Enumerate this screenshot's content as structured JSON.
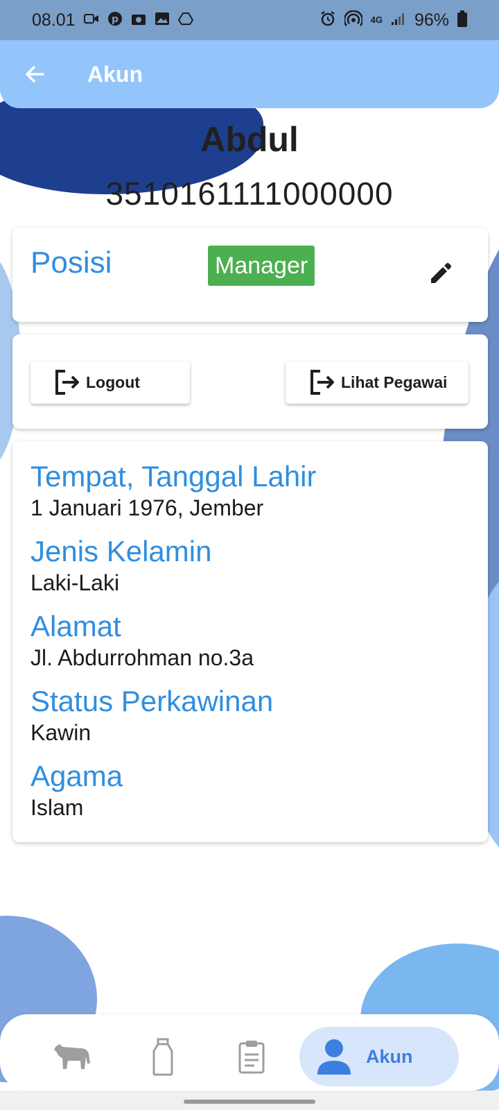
{
  "status_bar": {
    "time": "08.01",
    "battery": "96%",
    "network": "4G"
  },
  "app_bar": {
    "title": "Akun"
  },
  "profile": {
    "name": "Abdul",
    "nik": "3510161111000000"
  },
  "posisi": {
    "label": "Posisi",
    "value": "Manager"
  },
  "actions": {
    "logout": "Logout",
    "lihat_pegawai": "Lihat Pegawai"
  },
  "info": [
    {
      "label": "Tempat, Tanggal Lahir",
      "value": "1 Januari 1976, Jember"
    },
    {
      "label": "Jenis Kelamin",
      "value": "Laki-Laki"
    },
    {
      "label": "Alamat",
      "value": "Jl. Abdurrohman no.3a"
    },
    {
      "label": "Status Perkawinan",
      "value": "Kawin"
    },
    {
      "label": "Agama",
      "value": "Islam"
    }
  ],
  "bottom_nav": {
    "items": [
      {
        "icon": "cow-icon",
        "active": false
      },
      {
        "icon": "milk-bottle-icon",
        "active": false
      },
      {
        "icon": "clipboard-icon",
        "active": false
      },
      {
        "icon": "person-icon",
        "label": "Akun",
        "active": true
      }
    ]
  },
  "colors": {
    "app_bar": "#93c5fb",
    "label_blue": "#2f8ee0",
    "badge_green": "#4caf50",
    "nav_active_bg": "#d8e6fb",
    "nav_active_text": "#3d7fe0"
  }
}
